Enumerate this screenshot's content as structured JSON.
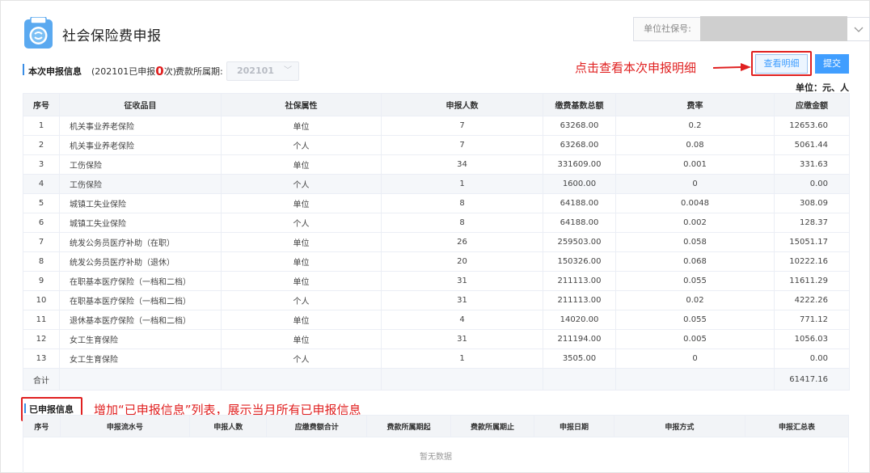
{
  "header": {
    "title": "社会保险费申报",
    "unit_label": "单位社保号:"
  },
  "info": {
    "title": "本次申报信息",
    "status_prefix": "(202101已申报",
    "status_count": "0",
    "status_suffix": "次)",
    "period_label": "费款所属期:",
    "period_value": "202101"
  },
  "annotations": {
    "detail_hint": "点击查看本次申报明细",
    "history_hint": "增加“已申报信息”列表，展示当月所有已申报信息"
  },
  "buttons": {
    "detail": "查看明细",
    "submit": "提交"
  },
  "units_text": "单位：元、人",
  "main_table": {
    "headers": [
      "序号",
      "征收品目",
      "社保属性",
      "申报人数",
      "缴费基数总额",
      "费率",
      "应缴金额"
    ],
    "rows": [
      [
        "1",
        "机关事业养老保险",
        "单位",
        "7",
        "63268.00",
        "0.2",
        "12653.60"
      ],
      [
        "2",
        "机关事业养老保险",
        "个人",
        "7",
        "63268.00",
        "0.08",
        "5061.44"
      ],
      [
        "3",
        "工伤保险",
        "单位",
        "34",
        "331609.00",
        "0.001",
        "331.63"
      ],
      [
        "4",
        "工伤保险",
        "个人",
        "1",
        "1600.00",
        "0",
        "0.00"
      ],
      [
        "5",
        "城镇工失业保险",
        "单位",
        "8",
        "64188.00",
        "0.0048",
        "308.09"
      ],
      [
        "6",
        "城镇工失业保险",
        "个人",
        "8",
        "64188.00",
        "0.002",
        "128.37"
      ],
      [
        "7",
        "统发公务员医疗补助（在职）",
        "单位",
        "26",
        "259503.00",
        "0.058",
        "15051.17"
      ],
      [
        "8",
        "统发公务员医疗补助（退休）",
        "单位",
        "20",
        "150326.00",
        "0.068",
        "10222.16"
      ],
      [
        "9",
        "在职基本医疗保险（一档和二档）",
        "单位",
        "31",
        "211113.00",
        "0.055",
        "11611.29"
      ],
      [
        "10",
        "在职基本医疗保险（一档和二档）",
        "个人",
        "31",
        "211113.00",
        "0.02",
        "4222.26"
      ],
      [
        "11",
        "退休基本医疗保险（一档和二档）",
        "单位",
        "4",
        "14020.00",
        "0.055",
        "771.12"
      ],
      [
        "12",
        "女工生育保险",
        "单位",
        "31",
        "211194.00",
        "0.005",
        "1056.03"
      ],
      [
        "13",
        "女工生育保险",
        "个人",
        "1",
        "3505.00",
        "0",
        "0.00"
      ]
    ],
    "total_label": "合计",
    "total_value": "61417.16"
  },
  "history": {
    "title": "已申报信息",
    "headers": [
      "序号",
      "申报流水号",
      "申报人数",
      "应缴费额合计",
      "费款所属期起",
      "费款所属期止",
      "申报日期",
      "申报方式",
      "申报汇总表"
    ],
    "empty_text": "暂无数据"
  },
  "colors": {
    "accent": "#409eff",
    "annotation": "#e02020"
  }
}
